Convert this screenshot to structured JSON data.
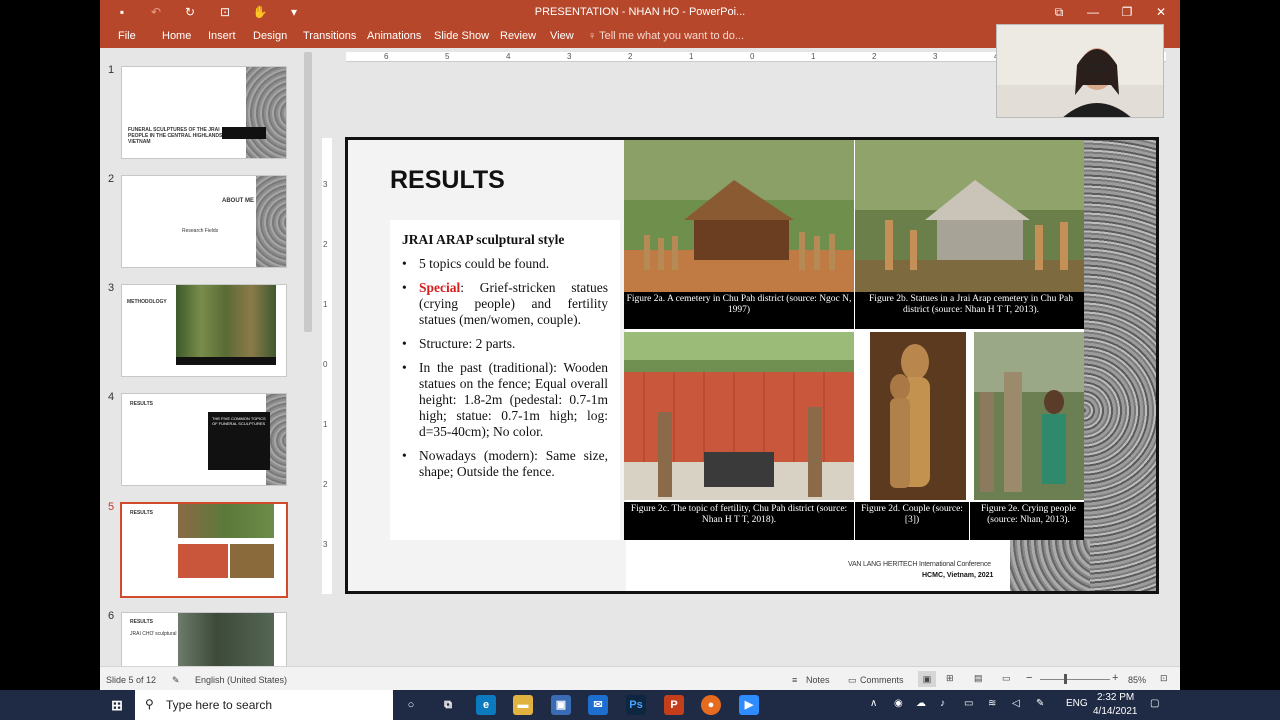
{
  "window": {
    "title": "PRESENTATION - NHAN HO - PowerPoi..."
  },
  "ribbon": {
    "tabs": [
      "File",
      "Home",
      "Insert",
      "Design",
      "Transitions",
      "Animations",
      "Slide Show",
      "Review",
      "View"
    ],
    "tell_me": "Tell me what you want to do..."
  },
  "thumbnails": {
    "numbers": [
      "1",
      "2",
      "3",
      "4",
      "5",
      "6"
    ],
    "t1": {
      "title": "FUNERAL SCULPTURES OF THE JRAI PEOPLE IN THE CENTRAL HIGHLANDS, VIETNAM"
    },
    "t2": {
      "title": "ABOUT ME",
      "fields": "Research Fields"
    },
    "t3": {
      "title": "METHODOLOGY"
    },
    "t4": {
      "title": "RESULTS",
      "box": "THE FIVE COMMON TOPICS OF FUNERAL SCULPTURES"
    },
    "t5": {
      "title": "RESULTS"
    },
    "t6": {
      "title": "RESULTS",
      "sub": "JRAI CHƠ sculptural style"
    }
  },
  "ruler": {
    "h": [
      "6",
      "5",
      "4",
      "3",
      "2",
      "1",
      "0",
      "1",
      "2",
      "3",
      "4",
      "5",
      "6"
    ],
    "v": [
      "3",
      "2",
      "1",
      "0",
      "1",
      "2",
      "3"
    ]
  },
  "slide": {
    "title": "RESULTS",
    "subtitle": "JRAI ARAP sculptural style",
    "bullets": {
      "b1": "5 topics could be found.",
      "b2_special": "Special",
      "b2_rest": ": Grief-stricken statues (crying people) and fertility statues (men/women, couple).",
      "b3": "Structure: 2 parts.",
      "b4": "In the past (traditional): Wooden statues on the fence; Equal overall height: 1.8-2m (pedestal: 0.7-1m high; statue: 0.7-1m high; log: d=35-40cm); No color.",
      "b5": "Nowadays (modern): Same size, shape; Outside the fence."
    },
    "captions": {
      "c2a": "Figure 2a. A cemetery in Chu Pah district (source: Ngoc N, 1997)",
      "c2b": "Figure 2b. Statues in a Jrai Arap cemetery in Chu Pah district (source: Nhan H T T, 2013).",
      "c2c": "Figure 2c. The topic of fertility, Chu Pah district (source: Nhan H T T, 2018).",
      "c2d": "Figure 2d. Couple (source: [3])",
      "c2e": "Figure 2e. Crying people (source: Nhan, 2013)."
    },
    "footer1": "VAN LANG HERITECH International Conference",
    "footer2": "HCMC, Vietnam, 2021"
  },
  "status": {
    "slide": "Slide 5 of 12",
    "lang": "English (United States)",
    "notes": "Notes",
    "comments": "Comments",
    "zoom": "85%"
  },
  "taskbar": {
    "search": "Type here to search",
    "lang": "ENG",
    "time": "2:32 PM",
    "date": "4/14/2021"
  },
  "colors": {
    "accent": "#b7472a",
    "special": "#d81e1e",
    "taskbar": "#1f2a44"
  }
}
